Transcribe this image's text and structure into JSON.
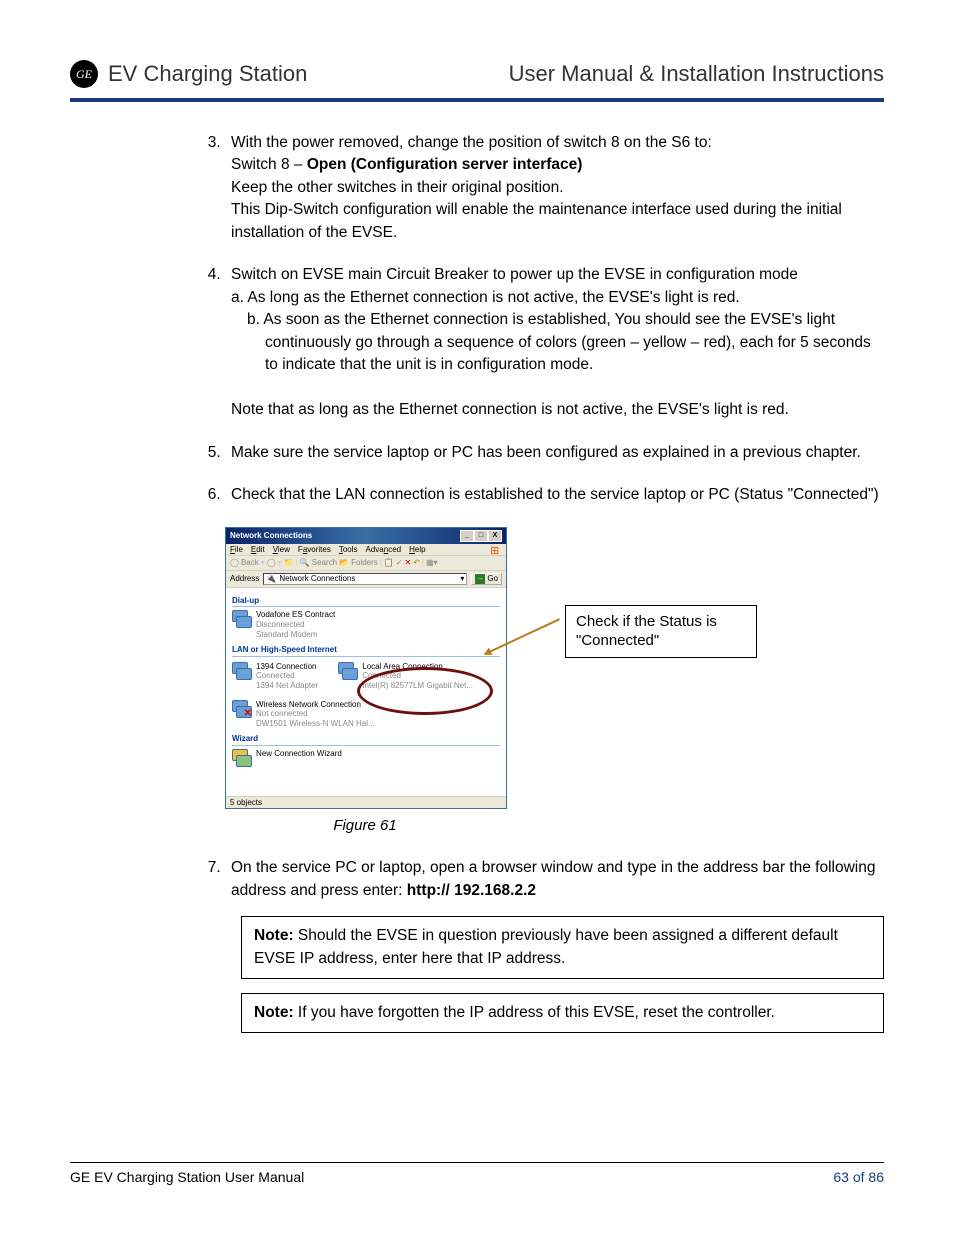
{
  "header": {
    "logo_text": "GE",
    "left_title": "EV Charging Station",
    "right_title": "User Manual & Installation Instructions"
  },
  "steps": {
    "s3": {
      "l1": "With the power removed, change the position of switch 8 on the S6 to:",
      "l2a": "Switch 8 – ",
      "l2b": "Open (Configuration server interface)",
      "l3": "Keep the other switches in their original position.",
      "l4": "This Dip-Switch configuration will enable the maintenance interface used during the initial installation of the EVSE."
    },
    "s4": {
      "l1": "Switch on EVSE main Circuit Breaker to power up the EVSE in configuration mode",
      "a": "a. As long as the Ethernet connection is not active, the EVSE's light is red.",
      "b": "b. As soon as the Ethernet connection is established, You should see the EVSE's light continuously go through a sequence of colors (green – yellow – red), each for 5 seconds to indicate that the unit is in configuration mode.",
      "note": "Note that as long as the Ethernet connection is not active, the EVSE's light is red."
    },
    "s5": "Make sure the service laptop or PC has been configured as explained in a previous chapter.",
    "s6": "Check that the LAN connection is established to the service laptop or PC (Status \"Connected\")",
    "s7": {
      "l1": "On the service PC or laptop, open a browser window and type in the address bar the following address and press enter: ",
      "url": "http:// 192.168.2.2"
    }
  },
  "screenshot": {
    "title": "Network Connections",
    "menu": {
      "file": "File",
      "edit": "Edit",
      "view": "View",
      "fav": "Favorites",
      "tools": "Tools",
      "adv": "Advanced",
      "help": "Help"
    },
    "toolbar": {
      "back": "Back",
      "search": "Search",
      "folders": "Folders"
    },
    "addr_label": "Address",
    "addr_value": "Network Connections",
    "go": "Go",
    "groups": {
      "dialup": "Dial-up",
      "lan": "LAN or High-Speed Internet",
      "wizard": "Wizard"
    },
    "conns": {
      "vodafone": {
        "name": "Vodafone ES Contract",
        "stat1": "Disconnected",
        "stat2": "Standard Modem"
      },
      "c1394": {
        "name": "1394 Connection",
        "stat1": "Connected",
        "stat2": "1394 Net Adapter"
      },
      "lac": {
        "name": "Local Area Connection",
        "stat1": "Connected",
        "stat2": "Intel(R) 82577LM Gigabit Net..."
      },
      "wifi": {
        "name": "Wireless Network Connection",
        "stat1": "Not connected",
        "stat2": "DW1501 Wireless-N WLAN Hal..."
      },
      "wiz": {
        "name": "New Connection Wizard"
      }
    },
    "status": "5 objects"
  },
  "callout": "Check if the Status is \"Connected\"",
  "figure_caption": "Figure 61",
  "notes": {
    "label": "Note:",
    "n1": " Should the EVSE in question previously have been assigned a different default EVSE IP address, enter here that IP address.",
    "n2": " If you have forgotten the IP address of this EVSE, reset the controller."
  },
  "footer": {
    "left": "GE EV Charging Station User Manual",
    "right": "63 of 86"
  }
}
